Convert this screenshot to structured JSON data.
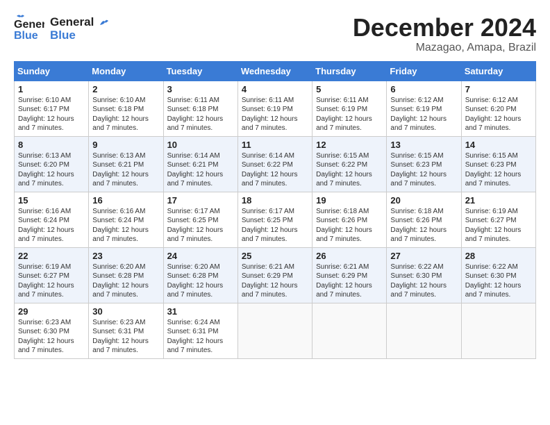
{
  "header": {
    "logo_line1": "General",
    "logo_line2": "Blue",
    "month": "December 2024",
    "location": "Mazagao, Amapa, Brazil"
  },
  "weekdays": [
    "Sunday",
    "Monday",
    "Tuesday",
    "Wednesday",
    "Thursday",
    "Friday",
    "Saturday"
  ],
  "weeks": [
    [
      {
        "day": "1",
        "info": "Sunrise: 6:10 AM\nSunset: 6:17 PM\nDaylight: 12 hours\nand 7 minutes."
      },
      {
        "day": "2",
        "info": "Sunrise: 6:10 AM\nSunset: 6:18 PM\nDaylight: 12 hours\nand 7 minutes."
      },
      {
        "day": "3",
        "info": "Sunrise: 6:11 AM\nSunset: 6:18 PM\nDaylight: 12 hours\nand 7 minutes."
      },
      {
        "day": "4",
        "info": "Sunrise: 6:11 AM\nSunset: 6:19 PM\nDaylight: 12 hours\nand 7 minutes."
      },
      {
        "day": "5",
        "info": "Sunrise: 6:11 AM\nSunset: 6:19 PM\nDaylight: 12 hours\nand 7 minutes."
      },
      {
        "day": "6",
        "info": "Sunrise: 6:12 AM\nSunset: 6:19 PM\nDaylight: 12 hours\nand 7 minutes."
      },
      {
        "day": "7",
        "info": "Sunrise: 6:12 AM\nSunset: 6:20 PM\nDaylight: 12 hours\nand 7 minutes."
      }
    ],
    [
      {
        "day": "8",
        "info": "Sunrise: 6:13 AM\nSunset: 6:20 PM\nDaylight: 12 hours\nand 7 minutes."
      },
      {
        "day": "9",
        "info": "Sunrise: 6:13 AM\nSunset: 6:21 PM\nDaylight: 12 hours\nand 7 minutes."
      },
      {
        "day": "10",
        "info": "Sunrise: 6:14 AM\nSunset: 6:21 PM\nDaylight: 12 hours\nand 7 minutes."
      },
      {
        "day": "11",
        "info": "Sunrise: 6:14 AM\nSunset: 6:22 PM\nDaylight: 12 hours\nand 7 minutes."
      },
      {
        "day": "12",
        "info": "Sunrise: 6:15 AM\nSunset: 6:22 PM\nDaylight: 12 hours\nand 7 minutes."
      },
      {
        "day": "13",
        "info": "Sunrise: 6:15 AM\nSunset: 6:23 PM\nDaylight: 12 hours\nand 7 minutes."
      },
      {
        "day": "14",
        "info": "Sunrise: 6:15 AM\nSunset: 6:23 PM\nDaylight: 12 hours\nand 7 minutes."
      }
    ],
    [
      {
        "day": "15",
        "info": "Sunrise: 6:16 AM\nSunset: 6:24 PM\nDaylight: 12 hours\nand 7 minutes."
      },
      {
        "day": "16",
        "info": "Sunrise: 6:16 AM\nSunset: 6:24 PM\nDaylight: 12 hours\nand 7 minutes."
      },
      {
        "day": "17",
        "info": "Sunrise: 6:17 AM\nSunset: 6:25 PM\nDaylight: 12 hours\nand 7 minutes."
      },
      {
        "day": "18",
        "info": "Sunrise: 6:17 AM\nSunset: 6:25 PM\nDaylight: 12 hours\nand 7 minutes."
      },
      {
        "day": "19",
        "info": "Sunrise: 6:18 AM\nSunset: 6:26 PM\nDaylight: 12 hours\nand 7 minutes."
      },
      {
        "day": "20",
        "info": "Sunrise: 6:18 AM\nSunset: 6:26 PM\nDaylight: 12 hours\nand 7 minutes."
      },
      {
        "day": "21",
        "info": "Sunrise: 6:19 AM\nSunset: 6:27 PM\nDaylight: 12 hours\nand 7 minutes."
      }
    ],
    [
      {
        "day": "22",
        "info": "Sunrise: 6:19 AM\nSunset: 6:27 PM\nDaylight: 12 hours\nand 7 minutes."
      },
      {
        "day": "23",
        "info": "Sunrise: 6:20 AM\nSunset: 6:28 PM\nDaylight: 12 hours\nand 7 minutes."
      },
      {
        "day": "24",
        "info": "Sunrise: 6:20 AM\nSunset: 6:28 PM\nDaylight: 12 hours\nand 7 minutes."
      },
      {
        "day": "25",
        "info": "Sunrise: 6:21 AM\nSunset: 6:29 PM\nDaylight: 12 hours\nand 7 minutes."
      },
      {
        "day": "26",
        "info": "Sunrise: 6:21 AM\nSunset: 6:29 PM\nDaylight: 12 hours\nand 7 minutes."
      },
      {
        "day": "27",
        "info": "Sunrise: 6:22 AM\nSunset: 6:30 PM\nDaylight: 12 hours\nand 7 minutes."
      },
      {
        "day": "28",
        "info": "Sunrise: 6:22 AM\nSunset: 6:30 PM\nDaylight: 12 hours\nand 7 minutes."
      }
    ],
    [
      {
        "day": "29",
        "info": "Sunrise: 6:23 AM\nSunset: 6:30 PM\nDaylight: 12 hours\nand 7 minutes."
      },
      {
        "day": "30",
        "info": "Sunrise: 6:23 AM\nSunset: 6:31 PM\nDaylight: 12 hours\nand 7 minutes."
      },
      {
        "day": "31",
        "info": "Sunrise: 6:24 AM\nSunset: 6:31 PM\nDaylight: 12 hours\nand 7 minutes."
      },
      {
        "day": "",
        "info": ""
      },
      {
        "day": "",
        "info": ""
      },
      {
        "day": "",
        "info": ""
      },
      {
        "day": "",
        "info": ""
      }
    ]
  ]
}
